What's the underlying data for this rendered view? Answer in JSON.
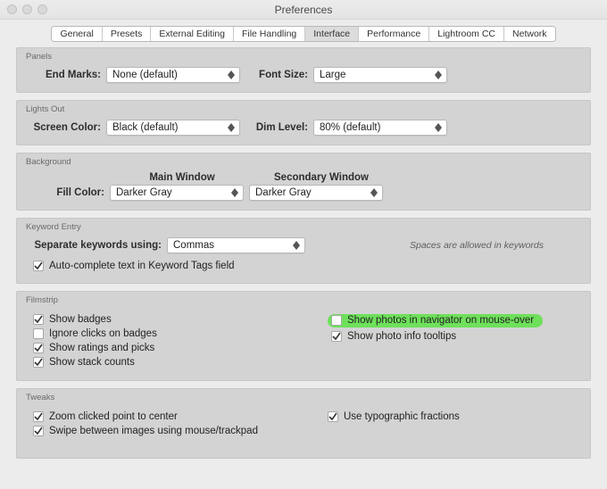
{
  "window": {
    "title": "Preferences"
  },
  "tabs": {
    "general": "General",
    "presets": "Presets",
    "external_editing": "External Editing",
    "file_handling": "File Handling",
    "interface": "Interface",
    "performance": "Performance",
    "lightroom_cc": "Lightroom CC",
    "network": "Network",
    "active": "interface"
  },
  "panels": {
    "section": "Panels",
    "end_marks_label": "End Marks:",
    "end_marks_value": "None (default)",
    "font_size_label": "Font Size:",
    "font_size_value": "Large"
  },
  "lights_out": {
    "section": "Lights Out",
    "screen_color_label": "Screen Color:",
    "screen_color_value": "Black (default)",
    "dim_level_label": "Dim Level:",
    "dim_level_value": "80% (default)"
  },
  "background": {
    "section": "Background",
    "main_window_header": "Main Window",
    "secondary_window_header": "Secondary Window",
    "fill_color_label": "Fill Color:",
    "main_value": "Darker Gray",
    "secondary_value": "Darker Gray"
  },
  "keyword_entry": {
    "section": "Keyword Entry",
    "separate_label": "Separate keywords using:",
    "separate_value": "Commas",
    "hint": "Spaces are allowed in keywords",
    "autocomplete_label": "Auto-complete text in Keyword Tags field",
    "autocomplete_checked": true
  },
  "filmstrip": {
    "section": "Filmstrip",
    "left": [
      {
        "label": "Show badges",
        "checked": true
      },
      {
        "label": "Ignore clicks on badges",
        "checked": false
      },
      {
        "label": "Show ratings and picks",
        "checked": true
      },
      {
        "label": "Show stack counts",
        "checked": true
      }
    ],
    "right": [
      {
        "label": "Show photos in navigator on mouse-over",
        "checked": false,
        "highlight": true
      },
      {
        "label": "Show photo info tooltips",
        "checked": true
      }
    ]
  },
  "tweaks": {
    "section": "Tweaks",
    "left": [
      {
        "label": "Zoom clicked point to center",
        "checked": true
      },
      {
        "label": "Swipe between images using mouse/trackpad",
        "checked": true
      }
    ],
    "right": [
      {
        "label": "Use typographic fractions",
        "checked": true
      }
    ]
  }
}
